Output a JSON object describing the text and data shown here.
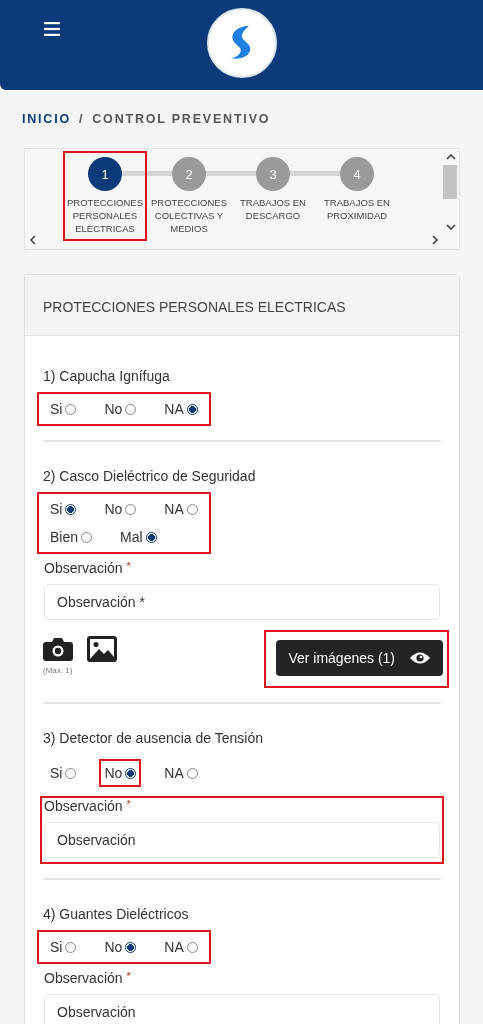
{
  "breadcrumb": {
    "items": [
      {
        "label": "INICIO",
        "kind": "link"
      },
      {
        "label": "CONTROL PREVENTIVO",
        "kind": "current"
      }
    ],
    "separator": "/"
  },
  "stepper": {
    "steps": [
      {
        "number": "1",
        "label": "PROTECCIONES PERSONALES ELECTRICAS",
        "selected": true,
        "highlighted": true
      },
      {
        "number": "2",
        "label": "PROTECCIONES COLECTIVAS Y MEDIOS",
        "selected": false,
        "highlighted": false
      },
      {
        "number": "3",
        "label": "TRABAJOS EN DESCARGO",
        "selected": false,
        "highlighted": false
      },
      {
        "number": "4",
        "label": "TRABAJOS EN PROXIMIDAD",
        "selected": false,
        "highlighted": false
      }
    ]
  },
  "section_title": "PROTECCIONES PERSONALES ELECTRICAS",
  "questions": [
    {
      "title": "1) Capucha Ignífuga",
      "options_highlighted": true,
      "option_rows": [
        [
          {
            "label": "Si",
            "selected": false,
            "highlighted": false
          },
          {
            "label": "No",
            "selected": false,
            "highlighted": false
          },
          {
            "label": "NA",
            "selected": true,
            "highlighted": false
          }
        ]
      ]
    },
    {
      "title": "2) Casco Dieléctrico de Seguridad",
      "options_highlighted": true,
      "option_rows": [
        [
          {
            "label": "Si",
            "selected": true,
            "highlighted": false
          },
          {
            "label": "No",
            "selected": false,
            "highlighted": false
          },
          {
            "label": "NA",
            "selected": false,
            "highlighted": false
          }
        ],
        [
          {
            "label": "Bien",
            "selected": false,
            "highlighted": false
          },
          {
            "label": "Mal",
            "selected": true,
            "highlighted": false
          }
        ]
      ],
      "observation": {
        "label": "Observación",
        "required_mark": "*",
        "placeholder": "Observación *",
        "highlighted": false
      },
      "media": {
        "note": "(Max. 1)",
        "button": {
          "label": "Ver imágenes (1)",
          "highlighted": true
        }
      }
    },
    {
      "title": "3) Detector de ausencia de Tensión",
      "options_highlighted": false,
      "option_rows": [
        [
          {
            "label": "Si",
            "selected": false,
            "highlighted": false
          },
          {
            "label": "No",
            "selected": true,
            "highlighted": true
          },
          {
            "label": "NA",
            "selected": false,
            "highlighted": false
          }
        ]
      ],
      "observation": {
        "label": "Observación",
        "required_mark": "*",
        "placeholder": "Observación",
        "highlighted": true
      }
    },
    {
      "title": "4) Guantes Dieléctricos",
      "options_highlighted": true,
      "option_rows": [
        [
          {
            "label": "Si",
            "selected": false,
            "highlighted": false
          },
          {
            "label": "No",
            "selected": true,
            "highlighted": false
          },
          {
            "label": "NA",
            "selected": false,
            "highlighted": false
          }
        ]
      ],
      "observation": {
        "label": "Observación",
        "required_mark": "*",
        "placeholder": "Observación",
        "highlighted": false
      }
    }
  ]
}
